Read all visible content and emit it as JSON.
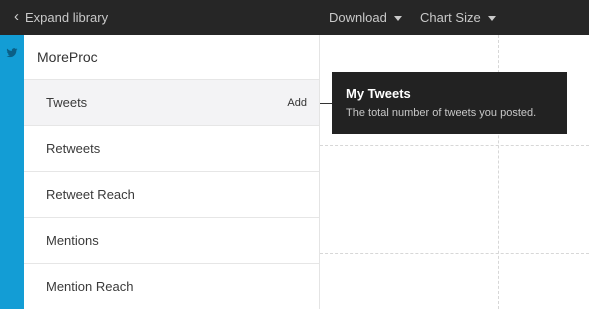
{
  "topbar": {
    "expand_label": "Expand library",
    "download_label": "Download",
    "chart_size_label": "Chart Size"
  },
  "library": {
    "account_name": "MoreProc",
    "metrics": [
      {
        "label": "Tweets",
        "add_label": "Add"
      },
      {
        "label": "Retweets"
      },
      {
        "label": "Retweet Reach"
      },
      {
        "label": "Mentions"
      },
      {
        "label": "Mention Reach"
      }
    ]
  },
  "tooltip": {
    "title": "My Tweets",
    "description": "The total number of tweets you posted."
  },
  "colors": {
    "topbar": "#262626",
    "twitter_rail": "#139dd5",
    "tooltip_bg": "#222222",
    "active_row": "#f3f3f5"
  },
  "icons": {
    "expand": "chevron-left-icon",
    "dropdown": "caret-down-icon",
    "service": "twitter-bird-icon"
  }
}
